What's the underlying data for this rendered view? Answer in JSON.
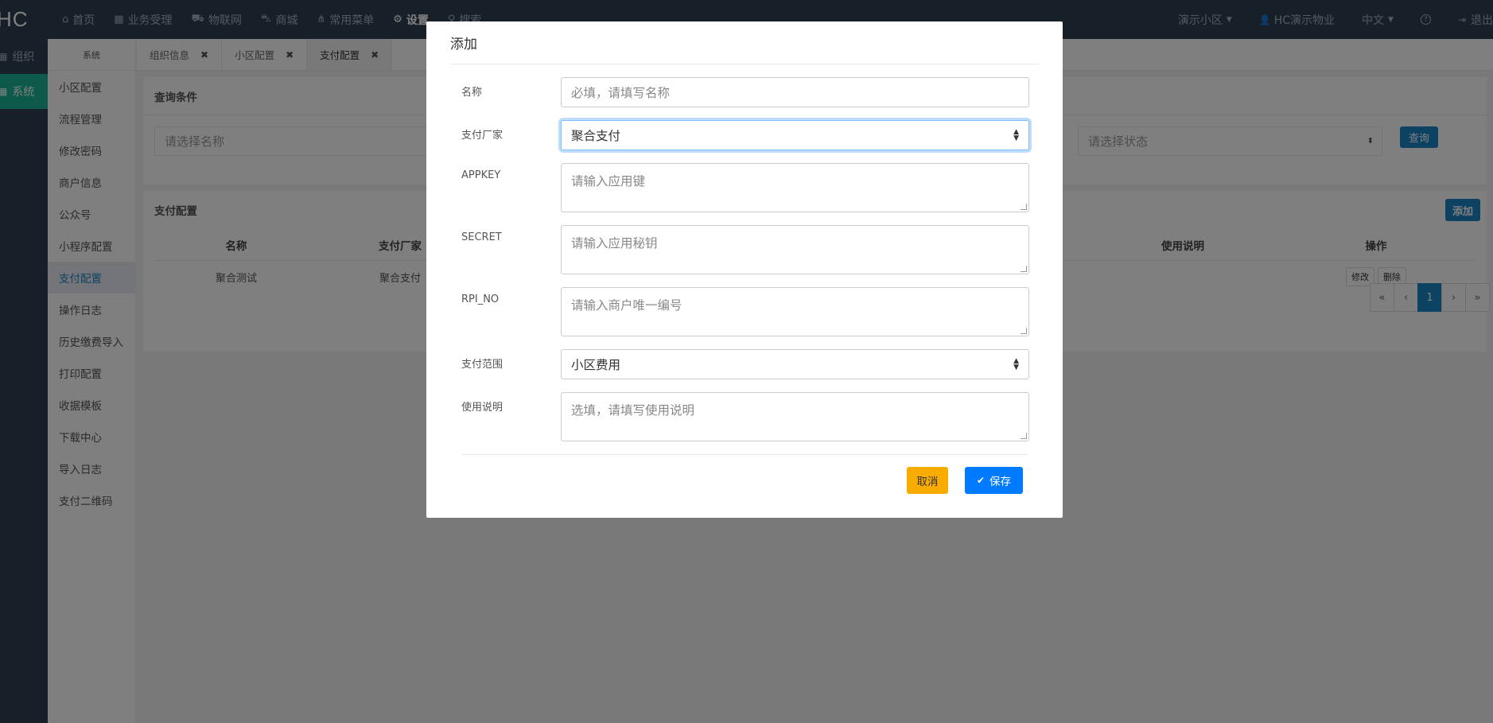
{
  "app": {
    "logo": "HC"
  },
  "topnav": {
    "items": [
      {
        "icon": "home-icon",
        "glyph": "⌂",
        "label": "首页"
      },
      {
        "icon": "calculator-icon",
        "glyph": "▦",
        "label": "业务受理"
      },
      {
        "icon": "car-icon",
        "glyph": "⛟",
        "label": "物联网"
      },
      {
        "icon": "cart-icon",
        "glyph": "⛍",
        "label": "商城"
      },
      {
        "icon": "sitemap-icon",
        "glyph": "⋔",
        "label": "常用菜单"
      },
      {
        "icon": "gear-icon",
        "glyph": "⚙",
        "label": "设置"
      },
      {
        "icon": "search-icon",
        "glyph": "⚲",
        "label": "搜索"
      }
    ],
    "right": {
      "community": "演示小区",
      "company": "HC演示物业",
      "language": "中文",
      "help_glyph": "?",
      "logout": "退出"
    }
  },
  "sidebar1": {
    "items": [
      {
        "label": "组织"
      },
      {
        "label": "系统"
      }
    ]
  },
  "sidebar2": {
    "header": "系统",
    "items": [
      {
        "label": "小区配置"
      },
      {
        "label": "流程管理"
      },
      {
        "label": "修改密码"
      },
      {
        "label": "商户信息"
      },
      {
        "label": "公众号"
      },
      {
        "label": "小程序配置"
      },
      {
        "label": "支付配置"
      },
      {
        "label": "操作日志"
      },
      {
        "label": "历史缴费导入"
      },
      {
        "label": "打印配置"
      },
      {
        "label": "收据模板"
      },
      {
        "label": "下载中心"
      },
      {
        "label": "导入日志"
      },
      {
        "label": "支付二维码"
      }
    ]
  },
  "tabs": [
    {
      "label": "组织信息"
    },
    {
      "label": "小区配置"
    },
    {
      "label": "支付配置"
    }
  ],
  "query": {
    "title": "查询条件",
    "name_placeholder": "请选择名称",
    "status_placeholder": "请选择状态",
    "query_button": "查询"
  },
  "grid": {
    "title": "支付配置",
    "add_button": "添加",
    "columns": [
      "名称",
      "支付厂家",
      "使用说明",
      "操作"
    ],
    "rows": [
      {
        "name": "聚合测试",
        "vendor": "聚合支付",
        "edit": "修改",
        "delete": "删除"
      }
    ],
    "pager": [
      "«",
      "‹",
      "1",
      "›",
      "»"
    ]
  },
  "modal": {
    "title": "添加",
    "fields": {
      "name": {
        "label": "名称",
        "placeholder": "必填，请填写名称"
      },
      "vendor": {
        "label": "支付厂家",
        "value": "聚合支付"
      },
      "appkey": {
        "label": "APPKEY",
        "placeholder": "请输入应用键"
      },
      "secret": {
        "label": "SECRET",
        "placeholder": "请输入应用秘钥"
      },
      "rpi_no": {
        "label": "RPI_NO",
        "placeholder": "请输入商户唯一编号"
      },
      "scope": {
        "label": "支付范围",
        "value": "小区费用"
      },
      "remark": {
        "label": "使用说明",
        "placeholder": "选填，请填写使用说明"
      }
    },
    "cancel_button": "取消",
    "save_button": "保存"
  }
}
